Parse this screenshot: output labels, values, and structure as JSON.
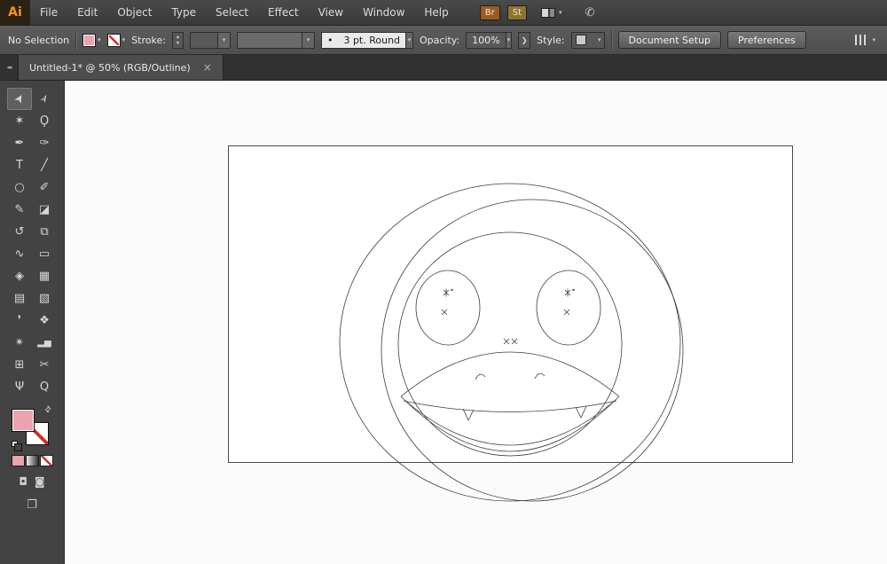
{
  "app": {
    "logo_text": "Ai"
  },
  "menubar": {
    "items": [
      "File",
      "Edit",
      "Object",
      "Type",
      "Select",
      "Effect",
      "View",
      "Window",
      "Help"
    ],
    "br_button": "Br",
    "st_button": "St"
  },
  "icons": {
    "caret_down": "▾",
    "caret_up": "▴",
    "collapse_left": "◂◂",
    "close": "×",
    "chevron_right": "❯",
    "swap": "⇄",
    "cs_live": "✆",
    "draw_normal": "◘",
    "draw_behind": "◙",
    "screen_mode": "❐"
  },
  "control_bar": {
    "selection_status": "No Selection",
    "stroke_label": "Stroke:",
    "brush_bullet": "•",
    "brush_profile": "3 pt. Round",
    "opacity_label": "Opacity:",
    "opacity_value": "100%",
    "style_label": "Style:",
    "document_setup_button": "Document Setup",
    "preferences_button": "Preferences"
  },
  "tab": {
    "title": "Untitled-1* @ 50% (RGB/Outline)"
  },
  "toolbar": {
    "tools": [
      {
        "name": "selection",
        "glyph": "➤"
      },
      {
        "name": "direct-selection",
        "glyph": "➢"
      },
      {
        "name": "magic-wand",
        "glyph": "✶"
      },
      {
        "name": "lasso",
        "glyph": "Ϙ"
      },
      {
        "name": "pen",
        "glyph": "✒"
      },
      {
        "name": "blob-brush",
        "glyph": "✑"
      },
      {
        "name": "type",
        "glyph": "T"
      },
      {
        "name": "line-segment",
        "glyph": "╱"
      },
      {
        "name": "ellipse",
        "glyph": "○"
      },
      {
        "name": "paintbrush",
        "glyph": "✐"
      },
      {
        "name": "pencil",
        "glyph": "✎"
      },
      {
        "name": "eraser",
        "glyph": "◪"
      },
      {
        "name": "rotate",
        "glyph": "↺"
      },
      {
        "name": "scale",
        "glyph": "⧉"
      },
      {
        "name": "width",
        "glyph": "∿"
      },
      {
        "name": "free-transform",
        "glyph": "▭"
      },
      {
        "name": "shape-builder",
        "glyph": "◈"
      },
      {
        "name": "perspective-grid",
        "glyph": "▦"
      },
      {
        "name": "mesh",
        "glyph": "▤"
      },
      {
        "name": "gradient",
        "glyph": "▧"
      },
      {
        "name": "eyedropper",
        "glyph": "❜"
      },
      {
        "name": "blend",
        "glyph": "❖"
      },
      {
        "name": "symbol-sprayer",
        "glyph": "✴"
      },
      {
        "name": "column-graph",
        "glyph": "▂▅"
      },
      {
        "name": "artboard",
        "glyph": "⊞"
      },
      {
        "name": "slice",
        "glyph": "✂"
      },
      {
        "name": "hand",
        "glyph": "Ψ"
      },
      {
        "name": "zoom",
        "glyph": "Q"
      }
    ]
  },
  "swatches": {
    "fill_color": "#eda3ae",
    "stroke": "none"
  },
  "colors": {
    "accent_pink": "#eda3ae",
    "logo_orange": "#f79322",
    "none_slash_red": "#d03028",
    "toolbar_bg": "#434343",
    "canvas_bg": "#fbfbfb"
  }
}
